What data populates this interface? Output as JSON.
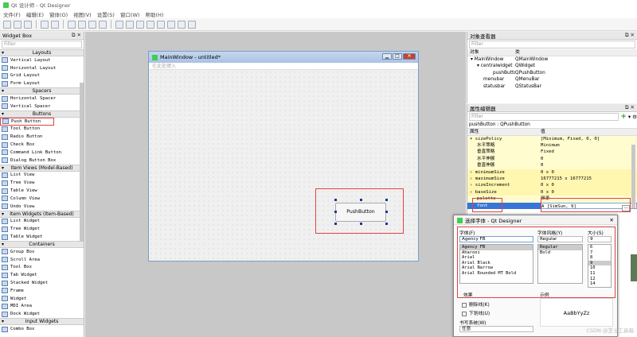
{
  "app": {
    "title": "Qt 设计师 - Qt Designer"
  },
  "menu": [
    "文件(F)",
    "编辑(E)",
    "窗体(O)",
    "视图(V)",
    "设置(S)",
    "窗口(W)",
    "帮助(H)"
  ],
  "widget_box": {
    "title": "Widget Box",
    "filter_placeholder": "Filter",
    "groups": [
      {
        "name": "Layouts",
        "items": [
          "Vertical Layout",
          "Horizontal Layout",
          "Grid Layout",
          "Form Layout"
        ]
      },
      {
        "name": "Spacers",
        "items": [
          "Horizontal Spacer",
          "Vertical Spacer"
        ]
      },
      {
        "name": "Buttons",
        "items": [
          "Push Button",
          "Tool Button",
          "Radio Button",
          "Check Box",
          "Command Link Button",
          "Dialog Button Box"
        ]
      },
      {
        "name": "Item Views (Model-Based)",
        "items": [
          "List View",
          "Tree View",
          "Table View",
          "Column View",
          "Undo View"
        ]
      },
      {
        "name": "Item Widgets (Item-Based)",
        "items": [
          "List Widget",
          "Tree Widget",
          "Table Widget"
        ]
      },
      {
        "name": "Containers",
        "items": [
          "Group Box",
          "Scroll Area",
          "Tool Box",
          "Tab Widget",
          "Stacked Widget",
          "Frame",
          "Widget",
          "MDI Area",
          "Dock Widget"
        ]
      },
      {
        "name": "Input Widgets",
        "items": [
          "Combo Box"
        ]
      }
    ]
  },
  "form": {
    "title": "MainWindow - untitled*",
    "menu_placeholder": "在此处键入",
    "push_button_text": "PushButton"
  },
  "object_inspector": {
    "title": "对象查看器",
    "filter_placeholder": "Filter",
    "headers": [
      "对象",
      "类"
    ],
    "rows": [
      {
        "object": "MainWindow",
        "class": "QMainWindow"
      },
      {
        "object": "centralwidget",
        "class": "QWidget"
      },
      {
        "object": "pushButton",
        "class": "QPushButton"
      },
      {
        "object": "menubar",
        "class": "QMenuBar"
      },
      {
        "object": "statusbar",
        "class": "QStatusBar"
      }
    ]
  },
  "property_editor": {
    "title": "属性编辑器",
    "filter_placeholder": "Filter",
    "class_line": "pushButton : QPushButton",
    "headers": [
      "属性",
      "值"
    ],
    "rows": [
      {
        "name": "sizePolicy",
        "value": "[Minimum, Fixed, 0, 0]",
        "style": "y1"
      },
      {
        "name": "水平策略",
        "value": "Minimum",
        "style": "y1"
      },
      {
        "name": "垂直策略",
        "value": "Fixed",
        "style": "y1"
      },
      {
        "name": "水平伸展",
        "value": "0",
        "style": "y1"
      },
      {
        "name": "垂直伸展",
        "value": "0",
        "style": "y1"
      },
      {
        "name": "minimumSize",
        "value": "0 x 0",
        "style": "y2"
      },
      {
        "name": "maximumSize",
        "value": "16777215 x 16777215",
        "style": "y2"
      },
      {
        "name": "sizeIncrement",
        "value": "0 x 0",
        "style": "y2"
      },
      {
        "name": "baseSize",
        "value": "0 x 0",
        "style": "y2"
      },
      {
        "name": "palette",
        "value": "继承",
        "style": "y1"
      },
      {
        "name": "font",
        "value": "A [SimSun, 9]",
        "style": "blue"
      }
    ]
  },
  "font_dialog": {
    "title": "选择字体 - Qt Designer",
    "font_label": "字体(F)",
    "font_value": "Agency FB",
    "fonts": [
      "Agency FB",
      "Aharoni",
      "Arial",
      "Arial Black",
      "Arial Narrow",
      "Arial Rounded MT Bold"
    ],
    "style_label": "字体风格(Y)",
    "style_value": "Regular",
    "styles": [
      "Regular",
      "Bold"
    ],
    "size_label": "大小(S)",
    "size_value": "9",
    "sizes": [
      "6",
      "7",
      "8",
      "9",
      "10",
      "11",
      "12",
      "14"
    ],
    "effects_label": "效果",
    "strikeout_label": "删除线(K)",
    "underline_label": "下划线(U)",
    "sample_label": "示例",
    "sample_text": "AaBbYyZz",
    "writing_system_label": "书写系统(W)",
    "writing_system_value": "任意"
  },
  "watermark": "CSDN @芝士工具箱",
  "colors": {
    "highlight": "#e04343",
    "selection": "#3875d6"
  }
}
